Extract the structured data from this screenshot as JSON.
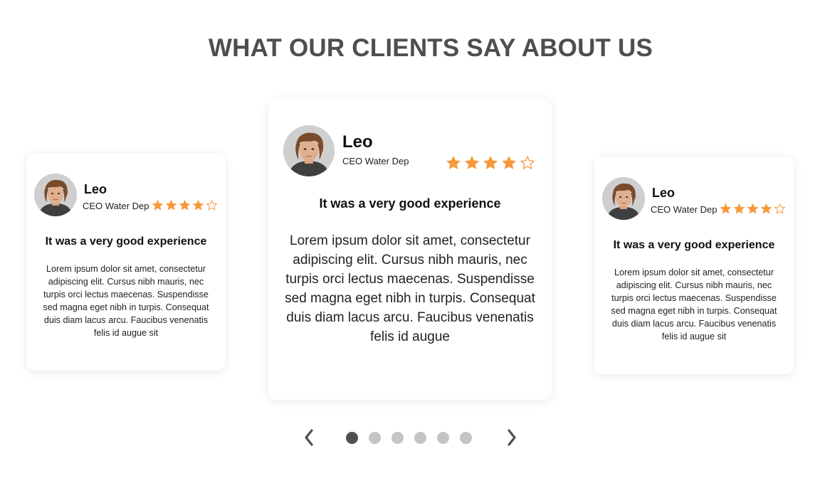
{
  "section": {
    "title": "WHAT OUR CLIENTS SAY ABOUT US"
  },
  "colors": {
    "star": "#f7993a",
    "title": "#4e4e4e",
    "dot_active": "#505050",
    "dot_inactive": "#c4c4c4"
  },
  "testimonials": [
    {
      "name": "Leo",
      "role": "CEO Water Dep",
      "rating": 4,
      "max_rating": 5,
      "headline": "It was a very good experience",
      "body": "Lorem ipsum dolor sit amet, consectetur adipiscing elit. Cursus nibh mauris, nec turpis orci lectus maecenas. Suspendisse sed magna eget nibh in turpis. Consequat duis diam lacus arcu. Faucibus venenatis felis id augue sit"
    },
    {
      "name": "Leo",
      "role": "CEO Water Dep",
      "rating": 4,
      "max_rating": 5,
      "headline": "It was a very good experience",
      "body": "Lorem ipsum dolor sit amet, consectetur adipiscing elit. Cursus nibh mauris, nec turpis orci lectus maecenas. Suspendisse sed magna eget nibh in turpis. Consequat duis diam lacus arcu. Faucibus venenatis felis id augue"
    },
    {
      "name": "Leo",
      "role": "CEO Water Dep",
      "rating": 4,
      "max_rating": 5,
      "headline": "It was a very good experience",
      "body": "Lorem ipsum dolor sit amet, consectetur adipiscing elit. Cursus nibh mauris, nec turpis orci lectus maecenas. Suspendisse sed magna eget nibh in turpis. Consequat duis diam lacus arcu. Faucibus venenatis felis id augue sit"
    }
  ],
  "pager": {
    "prev_icon": "chevron-left-icon",
    "next_icon": "chevron-right-icon",
    "dot_count": 6,
    "active_index": 0
  }
}
